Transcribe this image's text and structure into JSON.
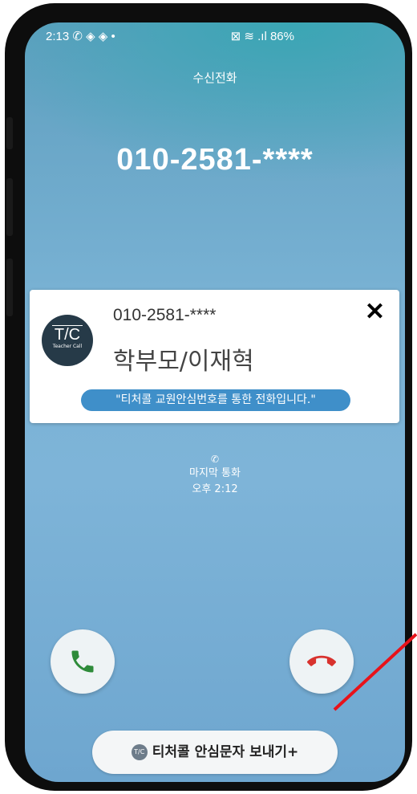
{
  "status_bar": {
    "time_and_icons": "2:13 ✆ ◈ ◈ •",
    "right_icons": "⊠ ≋ .ıl 86%"
  },
  "call": {
    "caption": "수신전화",
    "number": "010-2581-****"
  },
  "card": {
    "logo_text": "T/C",
    "logo_subtext": "Teacher Call",
    "number": "010-2581-****",
    "name": "학부모/이재혁",
    "close_label": "✕",
    "notice": "\"티처콜 교원안심번호를 통한 전화입니다.\""
  },
  "last_call": {
    "label": "마지막 통화",
    "time": "오후 2:12"
  },
  "actions": {
    "send_button_label": "티처콜 안심문자 보내기+",
    "send_button_badge": "T/C"
  },
  "colors": {
    "accept": "#2e8b3a",
    "decline": "#d8322e",
    "annotation_line": "#e8121a"
  }
}
